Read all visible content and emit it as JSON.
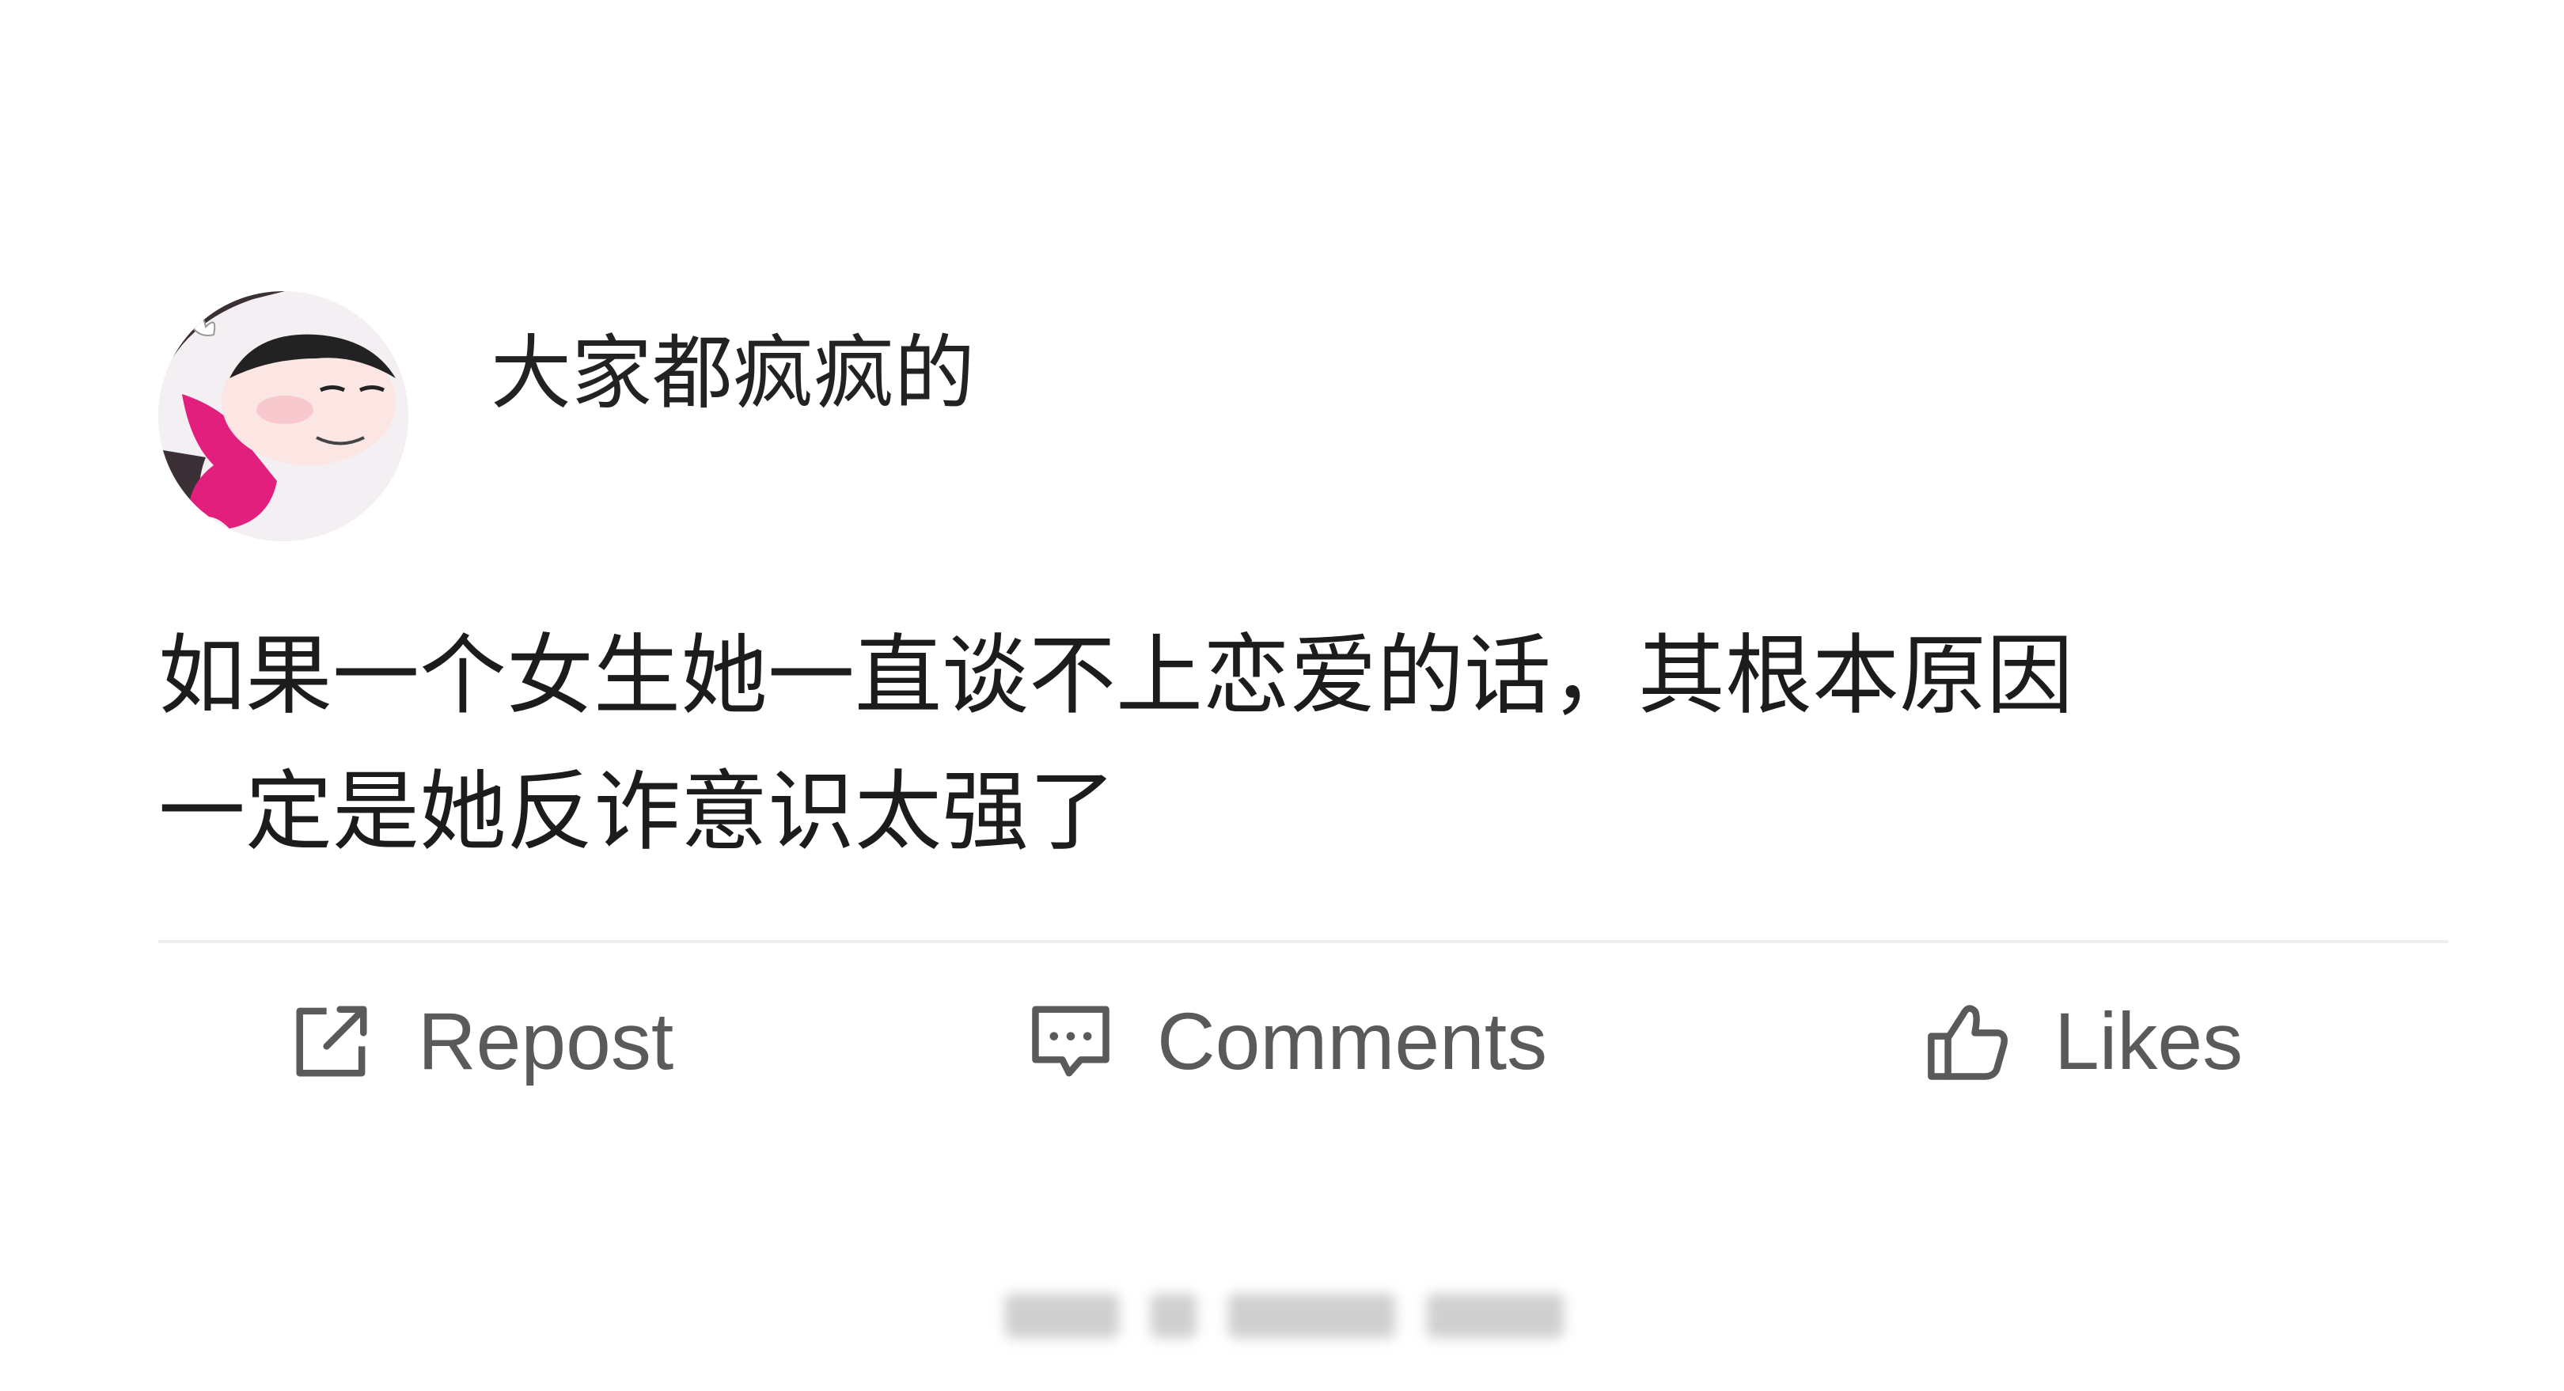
{
  "post": {
    "username": "大家都疯疯的",
    "text": "如果一个女生她一直谈不上恋爱的话，其根本原因\n一定是她反诈意识太强了",
    "avatar_icon": "cartoon-avatar-icon"
  },
  "actions": {
    "repost": {
      "label": "Repost",
      "icon": "repost-icon"
    },
    "comments": {
      "label": "Comments",
      "icon": "comment-icon"
    },
    "likes": {
      "label": "Likes",
      "icon": "thumbs-up-icon"
    }
  },
  "colors": {
    "text": "#1c1c1c",
    "action_text": "#5a5a5a",
    "avatar_accent": "#e21f7d",
    "divider": "#efefef",
    "background": "#ffffff"
  }
}
